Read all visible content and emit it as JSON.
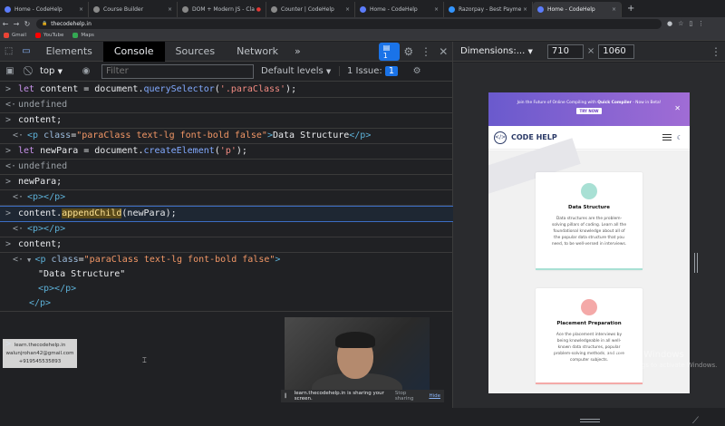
{
  "browser": {
    "tabs": [
      {
        "label": "Home - CodeHelp",
        "color": "#5b7cfa",
        "active": false
      },
      {
        "label": "Course Builder",
        "color": "#8a8a8a",
        "active": false
      },
      {
        "label": "DOM + Modern JS - Class I",
        "color": "#888888",
        "active": false
      },
      {
        "label": "Counter | CodeHelp",
        "color": "#8a8a8a",
        "active": false
      },
      {
        "label": "Home - CodeHelp",
        "color": "#5b7cfa",
        "active": false
      },
      {
        "label": "Razorpay - Best Payment Solu",
        "color": "#3395ff",
        "active": false
      },
      {
        "label": "Home - CodeHelp",
        "color": "#5b7cfa",
        "active": true
      }
    ],
    "new_tab": "+",
    "url": "thecodehelp.in",
    "bookmarks": [
      {
        "label": "Gmail",
        "color": "#ea4335"
      },
      {
        "label": "YouTube",
        "color": "#ff0000"
      },
      {
        "label": "Maps",
        "color": "#34a853"
      }
    ]
  },
  "devtools": {
    "tabs": [
      "Elements",
      "Console",
      "Sources",
      "Network"
    ],
    "active_tab": "Console",
    "more": "»",
    "message_count": "1",
    "context": "top",
    "filter_placeholder": "Filter",
    "default_levels": "Default levels",
    "issues_label": "1 Issue:",
    "issues_count": "1"
  },
  "console": {
    "prompt": ">"
  },
  "watermark_card": {
    "line1": "learn.thecodehelp.in",
    "line2": "walunjrohan42@gmail.com",
    "line3": "+919545535893"
  },
  "sharebar": {
    "message": "learn.thecodehelp.in is sharing your screen.",
    "stop": "Stop sharing",
    "hide": "Hide"
  },
  "device": {
    "dimensions_label": "Dimensions:...",
    "width": "710",
    "height": "1060",
    "times": "×"
  },
  "site": {
    "banner_prefix": "Join the Future of Online Compiling with ",
    "banner_bold": "Quick Compiler",
    "banner_suffix": " - Now in Beta!",
    "try_now": "TRY NOW",
    "name": "CODE HELP",
    "cards": [
      {
        "title": "Data Structure",
        "description": "Data structures are the problem-\nsolving pillars of coding. Learn all the\nfoundational knowledge about all of\nthe popular data structure that you\nneed, to be well-versed in interviews.",
        "icon_color": "#a8e0d4",
        "bar_color": "#a8e0d4"
      },
      {
        "title": "Placement Preparation",
        "description": "Ace the placement interviews by\nbeing knowledgeable in all well-\nknown data structures, popular\nproblem-solving methods, and core\ncomputer subjects.",
        "icon_color": "#f4a9a8",
        "bar_color": "#f4a9a8"
      }
    ]
  },
  "windows_activation": {
    "title": "Activate Windows",
    "subtitle": "Go to Settings to activate Windows."
  }
}
